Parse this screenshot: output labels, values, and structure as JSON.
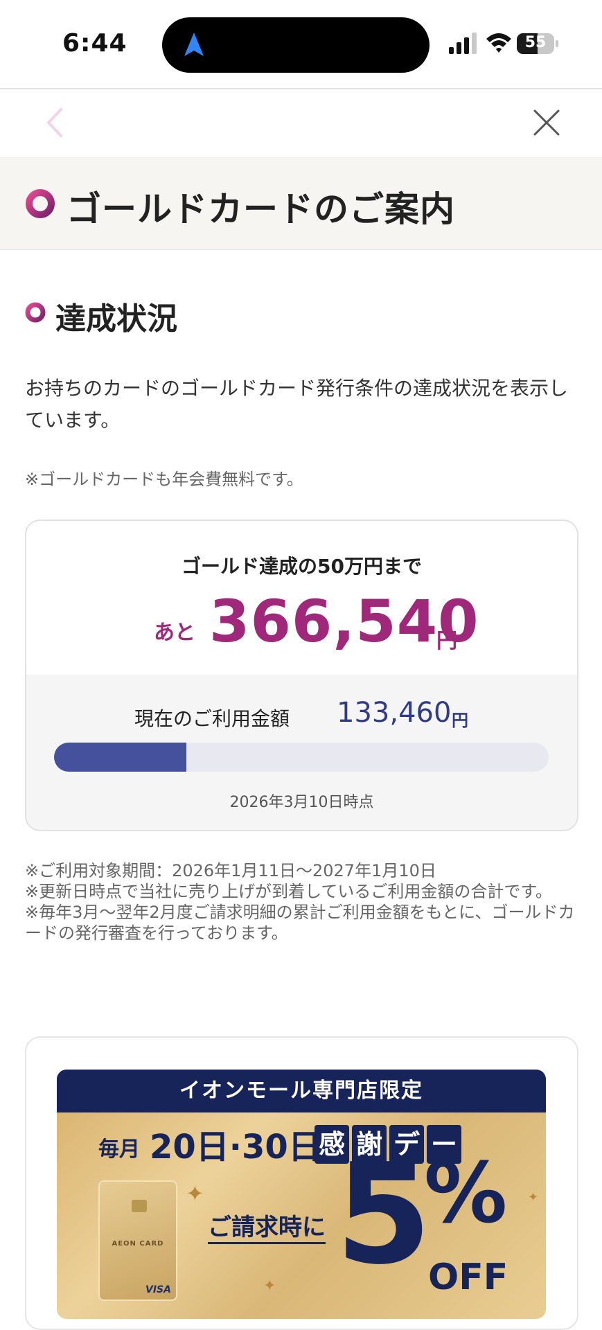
{
  "status_bar": {
    "time": "6:44",
    "battery": "55",
    "battery_level": 0.55
  },
  "header": {
    "title": "ゴールドカードのご案内"
  },
  "section": {
    "title": "達成状況",
    "description": "お持ちのカードのゴールドカード発行条件の達成状況を表示しています。",
    "note": "※ゴールドカードも年会費無料です。"
  },
  "progress": {
    "goal_label": "ゴールド達成の50万円まで",
    "remaining_prefix": "あと",
    "remaining_amount": "366,540",
    "yen": "円",
    "current_label": "現在のご利用金額",
    "current_amount": "133,460",
    "fraction": 0.267,
    "as_of": "2026年3月10日時点"
  },
  "footnotes": [
    "※ご利用対象期間：2026年1月11日～2027年1月10日",
    "※更新日時点で当社に売り上げが到着しているご利用金額の合計です。",
    "※毎年3月～翌年2月度ご請求明細の累計ご利用金額をもとに、ゴールドカードの発行審査を行っております。"
  ],
  "banner": {
    "header": "イオンモール専門店限定",
    "monthly": "毎月",
    "dates": "20日·30日",
    "kansha": [
      "感",
      "謝",
      "デ",
      "ー"
    ],
    "billing": "ご請求時に",
    "discount_number": "5",
    "percent": "%",
    "off": "OFF",
    "card_brand": "AEON CARD",
    "card_network": "VISA"
  }
}
